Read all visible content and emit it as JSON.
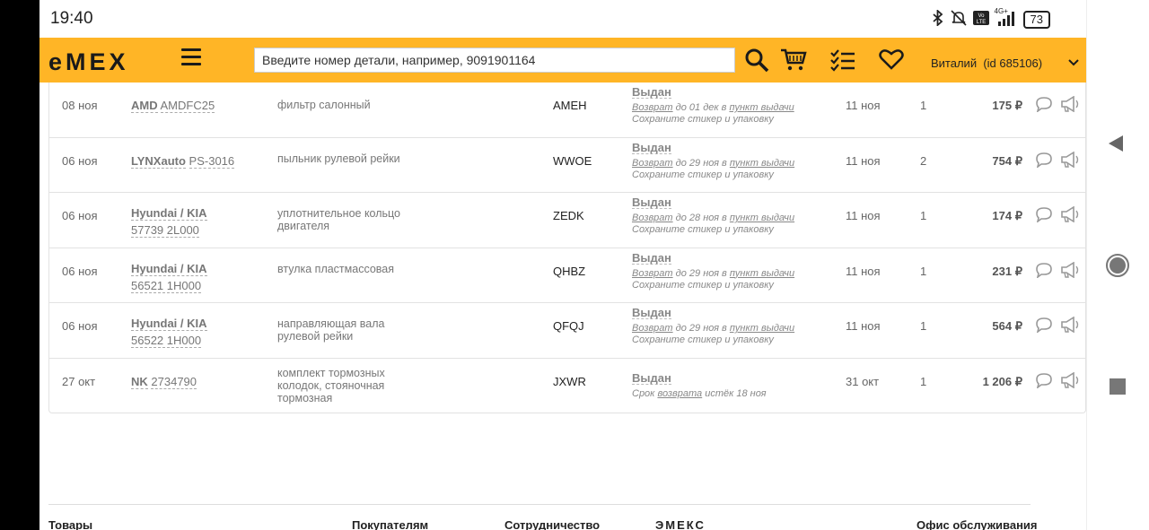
{
  "statusbar": {
    "time": "19:40",
    "battery": "73",
    "network": "4G+"
  },
  "header": {
    "logo": "eMEX",
    "search_placeholder": "Введите номер детали, например, 9091901164",
    "user_name": "Виталий",
    "user_id": "(id 685106)"
  },
  "orders": [
    {
      "date": "08 ноя",
      "brand": "AMD",
      "part": "AMDFC25",
      "name": "фильтр салонный",
      "code": "AMEH",
      "status": "Выдан",
      "return_text": "Возврат",
      "return_rest": " до 01 дек в ",
      "pickup": "пункт выдачи",
      "note": "Сохраните стикер и упаковку",
      "delivery": "11 ноя",
      "qty": "1",
      "price": "175 ₽"
    },
    {
      "date": "06 ноя",
      "brand": "LYNXauto",
      "part": "PS-3016",
      "name": "пыльник рулевой рейки",
      "code": "WWOE",
      "status": "Выдан",
      "return_text": "Возврат",
      "return_rest": " до 29 ноя в ",
      "pickup": "пункт выдачи",
      "note": "Сохраните стикер и упаковку",
      "delivery": "11 ноя",
      "qty": "2",
      "price": "754 ₽"
    },
    {
      "date": "06 ноя",
      "brand": "Hyundai / KIA",
      "part": "57739 2L000",
      "name": "уплотнительное кольцо двигателя",
      "code": "ZEDK",
      "status": "Выдан",
      "return_text": "Возврат",
      "return_rest": " до 28 ноя в ",
      "pickup": "пункт выдачи",
      "note": "Сохраните стикер и упаковку",
      "delivery": "11 ноя",
      "qty": "1",
      "price": "174 ₽"
    },
    {
      "date": "06 ноя",
      "brand": "Hyundai / KIA",
      "part": "56521 1H000",
      "name": "втулка пластмассовая",
      "code": "QHBZ",
      "status": "Выдан",
      "return_text": "Возврат",
      "return_rest": " до 29 ноя в ",
      "pickup": "пункт выдачи",
      "note": "Сохраните стикер и упаковку",
      "delivery": "11 ноя",
      "qty": "1",
      "price": "231 ₽"
    },
    {
      "date": "06 ноя",
      "brand": "Hyundai / KIA",
      "part": "56522 1H000",
      "name": "направляющая вала рулевой рейки",
      "code": "QFQJ",
      "status": "Выдан",
      "return_text": "Возврат",
      "return_rest": " до 29 ноя в ",
      "pickup": "пункт выдачи",
      "note": "Сохраните стикер и упаковку",
      "delivery": "11 ноя",
      "qty": "1",
      "price": "564 ₽"
    },
    {
      "date": "27 окт",
      "brand": "NK",
      "part": "2734790",
      "name": "комплект тормозных колодок, стояночная тормозная",
      "code": "JXWR",
      "status": "Выдан",
      "expired_pre": "Срок ",
      "expired_link": "возврата",
      "expired_post": " истёк 18 ноя",
      "delivery": "31 окт",
      "qty": "1",
      "price": "1 206 ₽"
    }
  ],
  "footer": {
    "col1": "Товары",
    "col2": "Покупателям",
    "col3": "Сотрудничество",
    "col4": "ЭМЕКС",
    "col5": "Офис обслуживания"
  },
  "colors": {
    "header_bg": "#ffb526"
  }
}
